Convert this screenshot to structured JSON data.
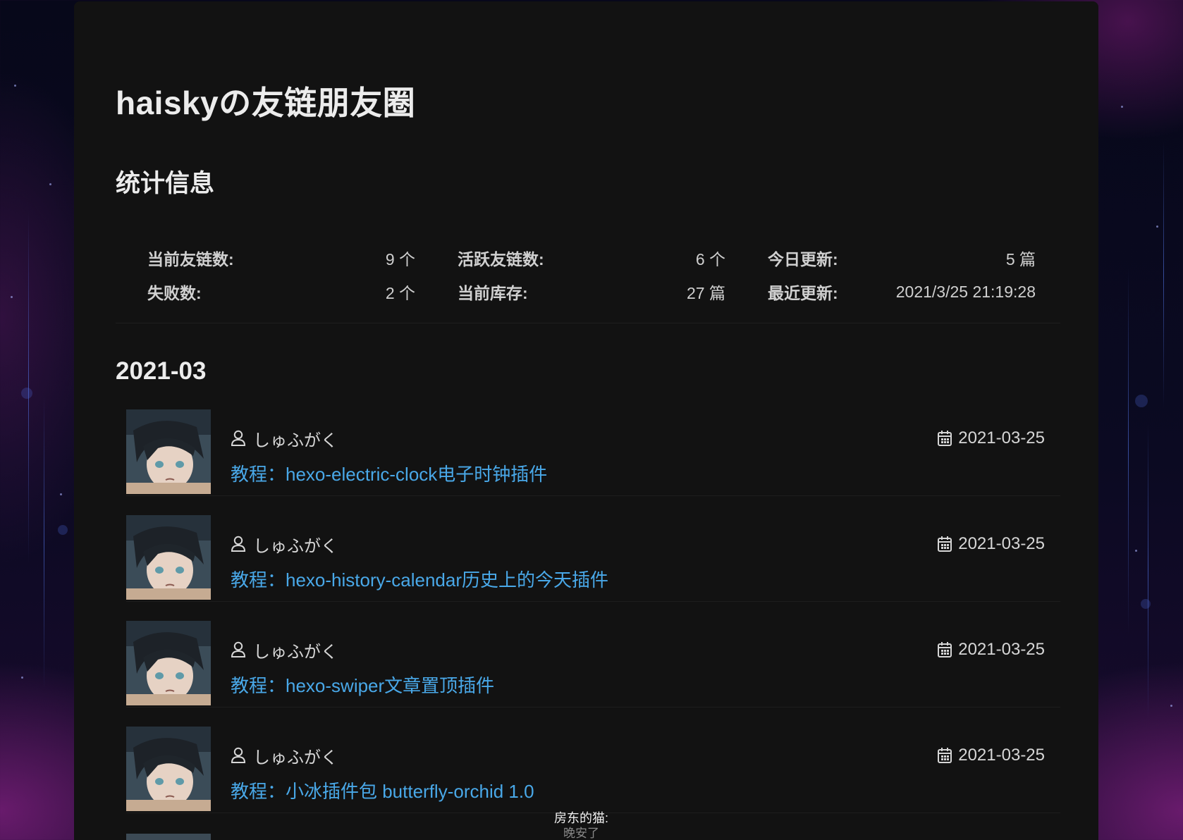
{
  "site": {
    "title": "haiskyの友链朋友圈"
  },
  "stats": {
    "heading": "统计信息",
    "items": [
      {
        "label": "当前友链数:",
        "value": "9 个"
      },
      {
        "label": "活跃友链数:",
        "value": "6 个"
      },
      {
        "label": "今日更新:",
        "value": "5 篇"
      },
      {
        "label": "失败数:",
        "value": "2 个"
      },
      {
        "label": "当前库存:",
        "value": "27 篇"
      },
      {
        "label": "最近更新:",
        "value": "2021/3/25 21:19:28"
      }
    ]
  },
  "month": "2021-03",
  "posts": [
    {
      "author": "しゅふがく",
      "date": "2021-03-25",
      "title": "教程：hexo-electric-clock电子时钟插件"
    },
    {
      "author": "しゅふがく",
      "date": "2021-03-25",
      "title": "教程：hexo-history-calendar历史上的今天插件"
    },
    {
      "author": "しゅふがく",
      "date": "2021-03-25",
      "title": "教程：hexo-swiper文章置顶插件"
    },
    {
      "author": "しゅふがく",
      "date": "2021-03-25",
      "title": "教程：小冰插件包 butterfly-orchid 1.0"
    }
  ],
  "footer": {
    "line1": "房东的猫:",
    "line2": "晚安了"
  },
  "colors": {
    "link": "#49a8e8",
    "card": "#121212",
    "text": "#ececec"
  },
  "icons": {
    "author": "user-icon",
    "date": "calendar-icon"
  }
}
